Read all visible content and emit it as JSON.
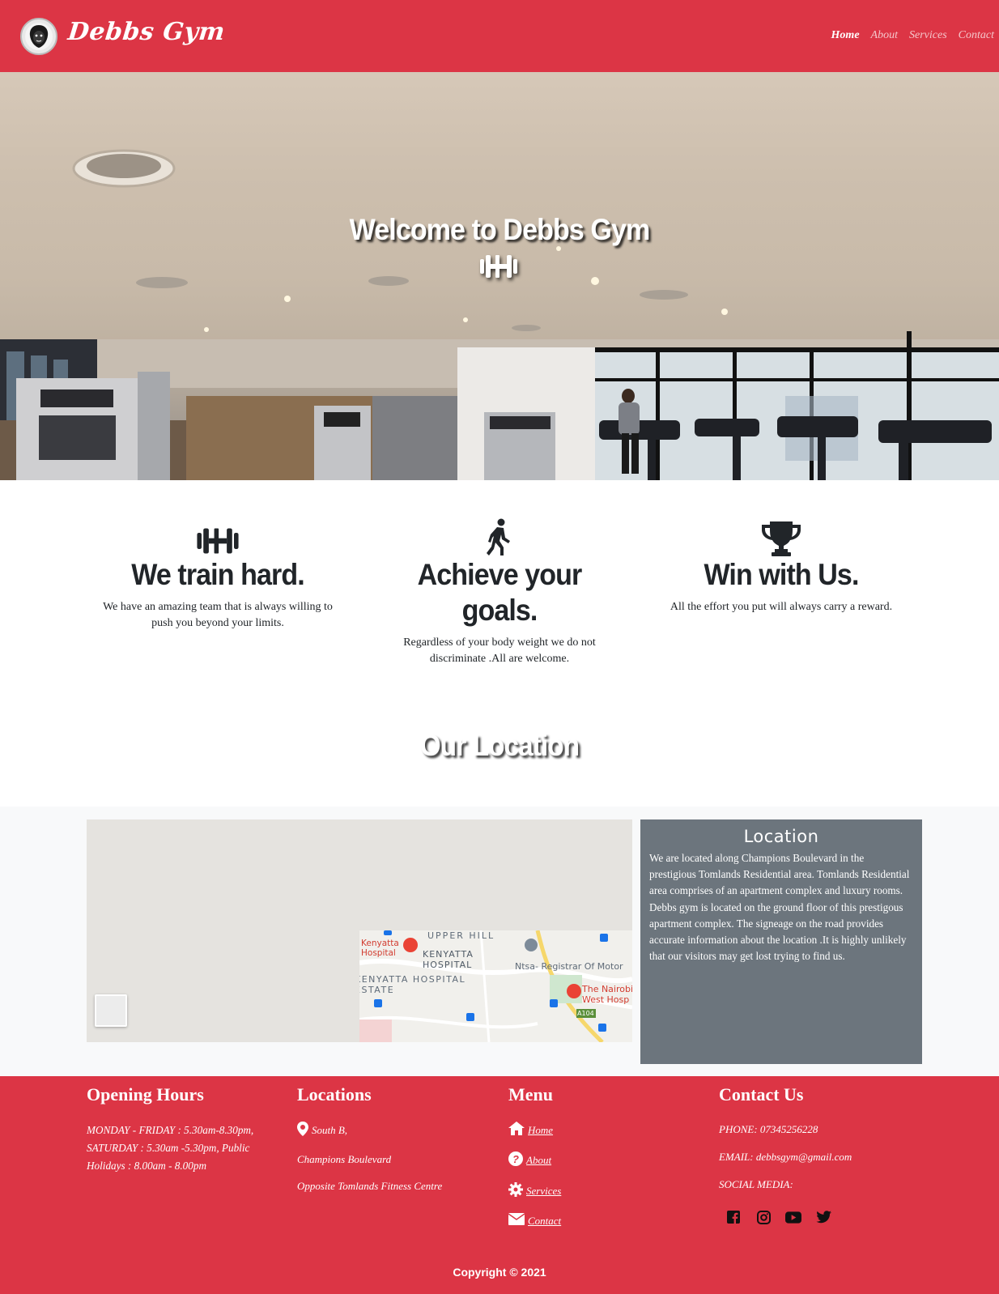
{
  "navbar": {
    "brand": "Debbs Gym",
    "logo_icon": "lion-logo-icon",
    "links": [
      {
        "label": "Home",
        "active": true
      },
      {
        "label": "About",
        "active": false
      },
      {
        "label": "Services",
        "active": false
      },
      {
        "label": "Contact",
        "active": false
      }
    ]
  },
  "hero": {
    "title": "Welcome to Debbs Gym",
    "icon": "dumbbell-icon"
  },
  "features": [
    {
      "icon": "dumbbell-icon",
      "title": "We train hard.",
      "text": "We have an amazing team that is always willing to push you beyond your limits."
    },
    {
      "icon": "walking-person-icon",
      "title": "Achieve your goals.",
      "text": "Regardless of your body weight we do not discriminate .All are welcome."
    },
    {
      "icon": "trophy-icon",
      "title": "Win with Us.",
      "text": "All the effort you put will always carry a reward."
    }
  ],
  "location": {
    "heading": "Our Location",
    "card_title": "Location",
    "card_text": "We are located along Champions Boulevard in the prestigious Tomlands Residential area. Tomlands Residential area comprises of an apartment complex and luxury rooms. Debbs gym is located on the ground floor of this prestigous apartment complex. The signeage on the road provides accurate information about the location .It is highly unlikely that our visitors may get lost trying to find us.",
    "map_labels": {
      "upper_hill": "UPPER HILL",
      "kenyatta_hospital": "Kenyatta Hospital",
      "kenyatta_hospital_caps": "KENYATTA HOSPITAL",
      "ntsa": "Ntsa- Registrar Of Motor",
      "estate": "KENYATTA HOSPITAL ESTATE",
      "nairobi_west": "The Nairobi West Hosp",
      "road": "A104"
    }
  },
  "footer": {
    "opening": {
      "title": "Opening Hours",
      "text": "MONDAY - FRIDAY : 5.30am-8.30pm, SATURDAY : 5.30am -5.30pm, Public Holidays : 8.00am - 8.00pm"
    },
    "locations": {
      "title": "Locations",
      "line1": "South B,",
      "line2": "Champions Boulevard",
      "line3": "Opposite Tomlands Fitness Centre"
    },
    "menu": {
      "title": "Menu",
      "items": [
        {
          "label": "Home",
          "icon": "home-icon"
        },
        {
          "label": "About",
          "icon": "question-circle-icon"
        },
        {
          "label": "Services",
          "icon": "gear-icon"
        },
        {
          "label": "Contact",
          "icon": "envelope-icon"
        }
      ]
    },
    "contact": {
      "title": "Contact Us",
      "phone": "PHONE: 07345256228",
      "email": "EMAIL: debbsgym@gmail.com",
      "social_label": "SOCIAL MEDIA:",
      "social": [
        "facebook-icon",
        "instagram-icon",
        "youtube-icon",
        "twitter-icon"
      ]
    },
    "copyright": "Copyright © 2021"
  },
  "colors": {
    "brand_red": "#dc3545",
    "card_gray": "#6c757d",
    "light_bg": "#f8f9fa",
    "dark_text": "#212529"
  }
}
